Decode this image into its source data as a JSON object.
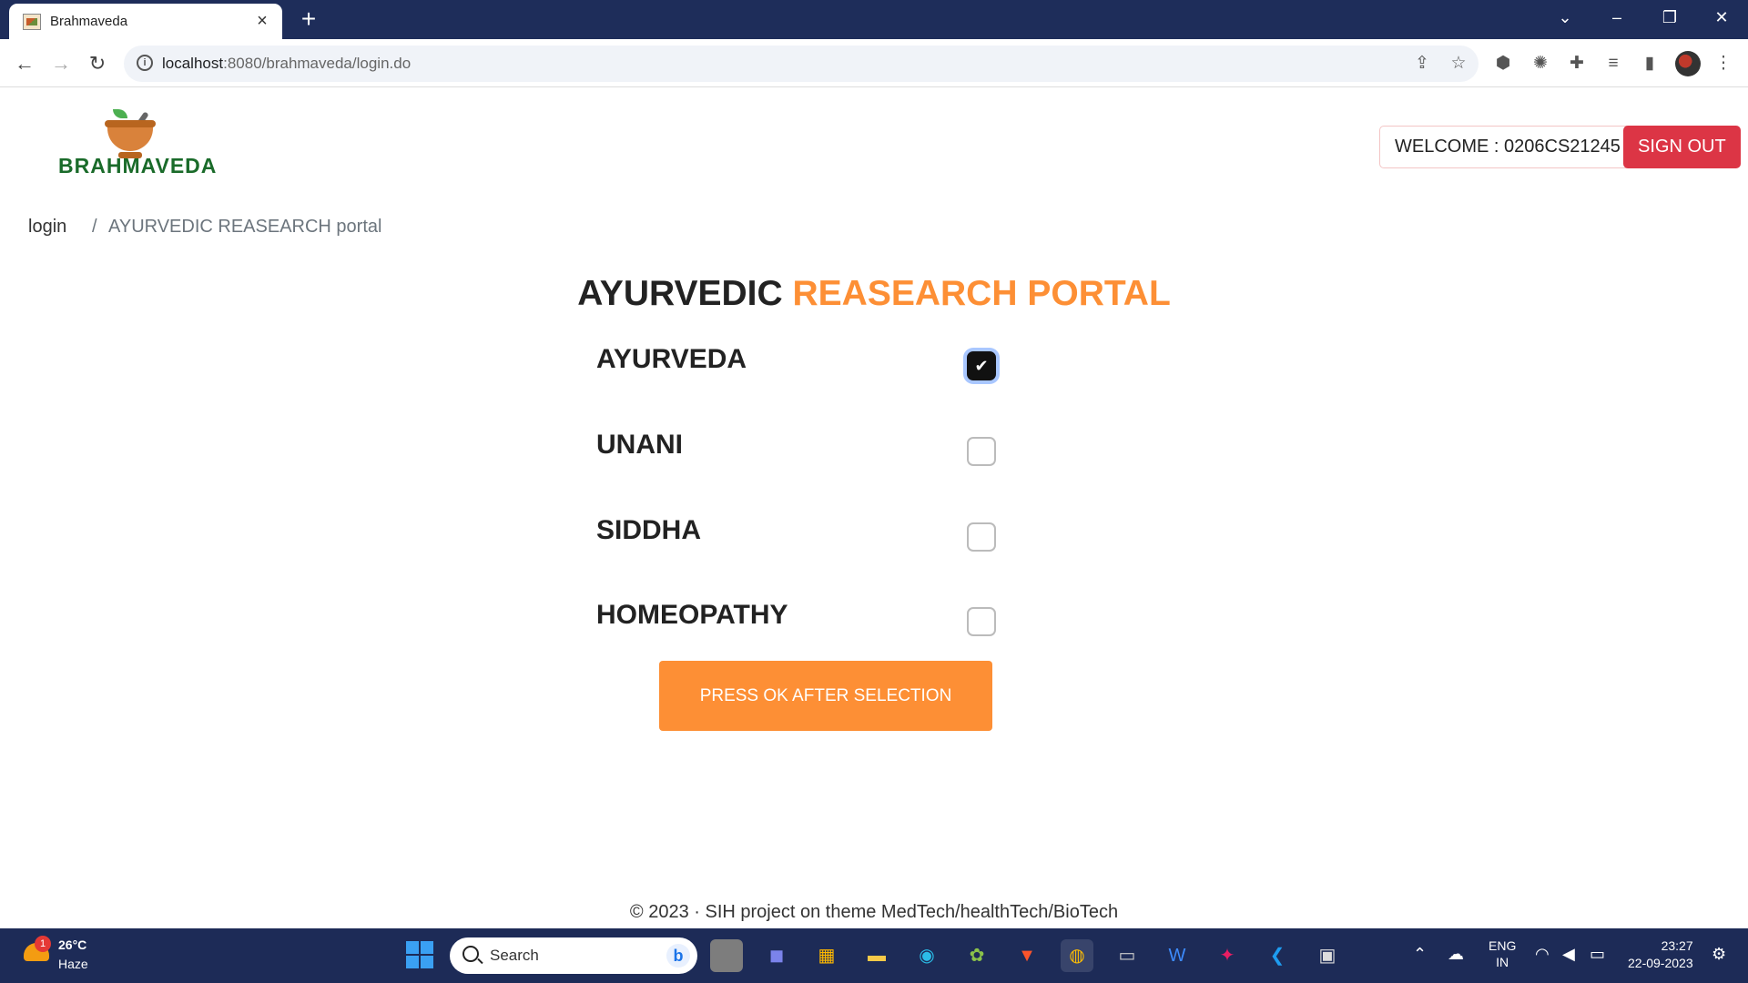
{
  "browser": {
    "tab_title": "Brahmaveda",
    "url_host": "localhost",
    "url_rest": ":8080/brahmaveda/login.do"
  },
  "header": {
    "logo_text": "BRAHMAVEDA",
    "welcome_text": "WELCOME : 0206CS21245",
    "signout_label": "SIGN OUT"
  },
  "breadcrumb": {
    "login": "login",
    "separator": "/",
    "current": "AYURVEDIC REASEARCH portal"
  },
  "heading": {
    "part1": "AYURVEDIC",
    "part2": "REASEARCH PORTAL"
  },
  "options": [
    {
      "label": "AYURVEDA",
      "checked": true
    },
    {
      "label": "UNANI",
      "checked": false
    },
    {
      "label": "SIDDHA",
      "checked": false
    },
    {
      "label": "HOMEOPATHY",
      "checked": false
    }
  ],
  "ok_button": "PRESS OK AFTER SELECTION",
  "footer": "© 2023 · SIH project on theme MedTech/healthTech/BioTech",
  "taskbar": {
    "weather_temp": "26°C",
    "weather_desc": "Haze",
    "weather_badge": "1",
    "search_placeholder": "Search",
    "lang_line1": "ENG",
    "lang_line2": "IN",
    "time": "23:27",
    "date": "22-09-2023"
  },
  "colors": {
    "accent_orange": "#fd8f35",
    "signout_red": "#dc3545",
    "logo_green": "#1a6b2a",
    "taskbar_bg": "#1d2b57"
  }
}
